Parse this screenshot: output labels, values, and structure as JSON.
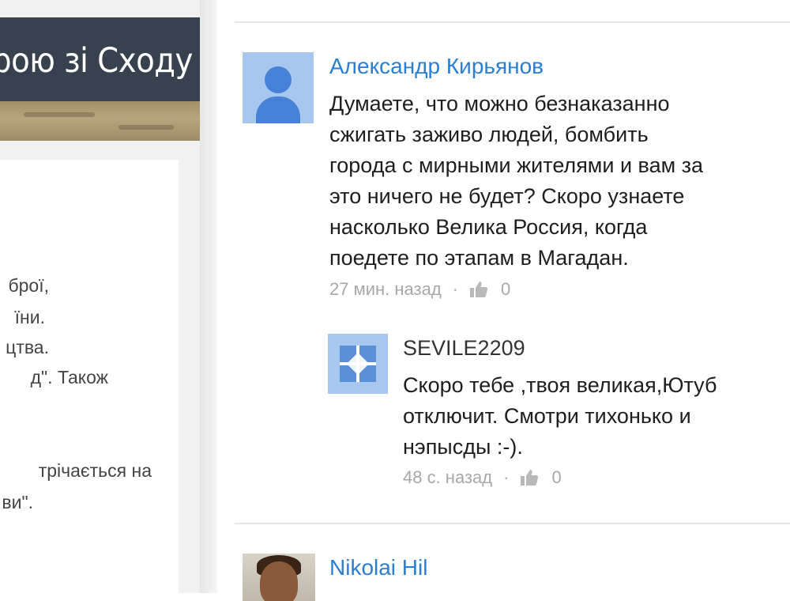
{
  "video": {
    "title": "рою зі Сходу"
  },
  "description": {
    "lines": [
      "брої,",
      "їни.",
      "цтва.",
      "д\". Також",
      "трічається на",
      "ви\"."
    ]
  },
  "comments": [
    {
      "author": "Александр Кирьянов",
      "text": "Думаете, что можно безнаказанно\nсжигать заживо людей, бомбить\nгорода с мирными жителями и вам за\nэто ничего не будет? Скоро узнаете\nнасколько Велика Россия, когда\nпоедете по этапам в Магадан.",
      "time": "27 мин. назад",
      "likes": "0",
      "avatar_icon": "default-user-avatar-icon",
      "reply": {
        "author": "SEVILE2209",
        "text": "Скоро тебе ,твоя великая,Ютуб\nотключит. Смотри тихонько и\nнэпысды :-).",
        "time": "48 с. назад",
        "likes": "0",
        "avatar_icon": "pattern-avatar-icon"
      }
    },
    {
      "author": "Nikolai Hil",
      "avatar_icon": "photo-avatar-icon"
    }
  ],
  "meta": {
    "separator": "·"
  },
  "colors": {
    "title_bar": "#38424f",
    "author_link": "#2a7fd4",
    "meta_gray": "#a8a8a8",
    "avatar_bg": "#a7c7ef",
    "avatar_fg": "#4782d8"
  }
}
